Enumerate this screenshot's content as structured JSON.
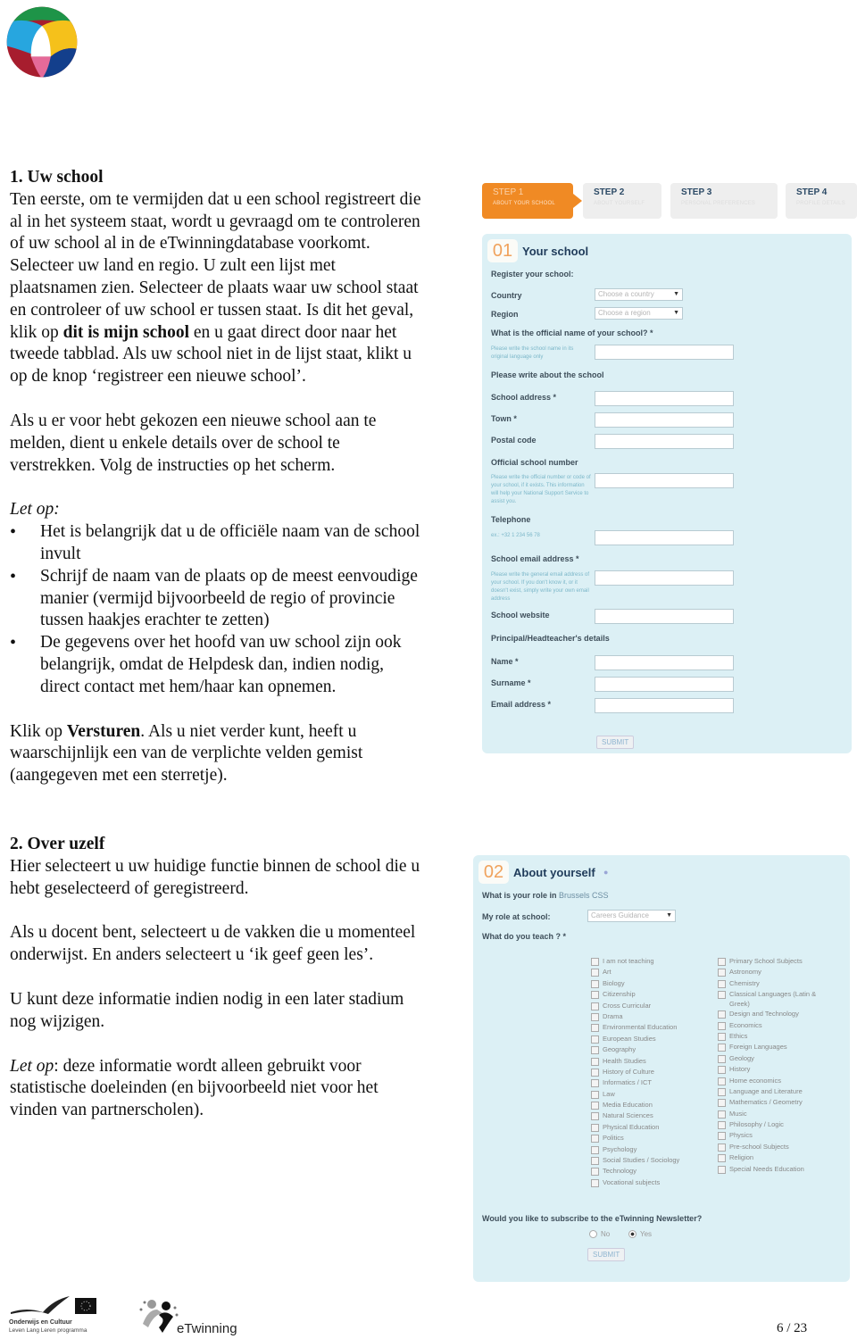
{
  "header": {
    "logo": "colored-circle-logo"
  },
  "section1": {
    "heading": "1. Uw school",
    "para1_lines": [
      "Ten eerste, om te vermijden dat u een school registreert die",
      "al in het systeem staat, wordt u gevraagd om te controleren",
      "of uw school al in de eTwinningdatabase voorkomt.",
      "Selecteer uw land en regio. U zult een lijst met",
      "plaatsnamen zien. Selecteer de plaats waar uw school staat",
      "en controleer of uw school er tussen staat. Is dit het geval,"
    ],
    "para1_l7_pre": "klik op ",
    "para1_l7_bold": "dit is mijn school",
    "para1_l7_post": " en u gaat direct door naar het",
    "para1_l8": "tweede tabblad. Als uw school niet in de lijst staat, klikt u",
    "para1_l9": "op de knop ‘registreer een nieuwe school’.",
    "para2_lines": [
      "Als u er voor hebt gekozen een nieuwe school aan te",
      "melden, dient u enkele details over de school te",
      "verstrekken. Volg de instructies op het scherm."
    ],
    "note_label": "Let op:",
    "bullets": [
      [
        "Het is belangrijk dat u de officiële naam van de school",
        "invult"
      ],
      [
        "Schrijf de naam van de plaats op de meest eenvoudige",
        "manier (vermijd bijvoorbeeld de regio of provincie",
        "tussen haakjes erachter te zetten)"
      ],
      [
        "De gegevens over het hoofd van uw school zijn ook",
        "belangrijk, omdat de Helpdesk dan, indien nodig,",
        "direct contact met hem/haar kan opnemen."
      ]
    ],
    "para3_pre": "Klik op ",
    "para3_bold": "Versturen",
    "para3_post": ". Als u niet verder kunt, heeft u",
    "para3_l2": "waarschijnlijk een van de verplichte velden gemist",
    "para3_l3": "(aangegeven met een sterretje)."
  },
  "steps": [
    {
      "title": "STEP 1",
      "subtitle": "ABOUT YOUR SCHOOL",
      "active": true
    },
    {
      "title": "STEP 2",
      "subtitle": "ABOUT YOURSELF",
      "active": false
    },
    {
      "title": "STEP 3",
      "subtitle": "PERSONAL PREFERENCES",
      "active": false
    },
    {
      "title": "STEP 4",
      "subtitle": "PROFILE DETAILS",
      "active": false
    }
  ],
  "form1": {
    "number": "01",
    "title": "Your school",
    "register_label": "Register your school:",
    "country_label": "Country",
    "country_value": "Choose a country",
    "region_label": "Region",
    "region_value": "Choose a region",
    "official_name_q": "What is the official name of your school? *",
    "official_name_hint": "Please write the school name in its original language only",
    "write_about": "Please write about the school",
    "address_label": "School address *",
    "town_label": "Town *",
    "postal_label": "Postal code",
    "school_number_label": "Official school number",
    "school_number_hint": "Please write the official number or code of your school, if it exists. This information will help your National Support Service to assist you.",
    "telephone_label": "Telephone",
    "telephone_hint": "ex.: +32 1 234 56 78",
    "email_label": "School email address *",
    "email_hint": "Please write the general email address of your school. If you don't know it, or it doesn't exist, simply write your own email address",
    "website_label": "School website",
    "principal_heading": "Principal/Headteacher's details",
    "name_label": "Name *",
    "surname_label": "Surname *",
    "principal_email_label": "Email address *",
    "submit": "SUBMIT"
  },
  "section2": {
    "heading": "2. Over uzelf",
    "p1": [
      "Hier selecteert u uw huidige functie binnen de school die u",
      "hebt geselecteerd of geregistreerd."
    ],
    "p2": [
      "Als u docent bent, selecteert u de vakken die u momenteel",
      "onderwijst. En anders selecteert u ‘ik geef geen les’."
    ],
    "p3": [
      "U kunt deze informatie indien nodig in een later stadium",
      "nog wijzigen."
    ],
    "p4_label": "Let op",
    "p4_l1": ": deze informatie wordt alleen gebruikt voor",
    "p4_l2": "statistische doeleinden (en bijvoorbeeld niet voor het",
    "p4_l3": "vinden van partnerscholen)."
  },
  "form2": {
    "number": "02",
    "title": "About yourself",
    "role_q_pre": "What is your role in ",
    "role_q_school": "Brussels CSS",
    "role_label": "My role at school:",
    "role_value": "Careers Guidance",
    "teach_q": "What do you teach ? *",
    "subjects_left": [
      "I am not teaching",
      "Art",
      "Biology",
      "Citizenship",
      "Cross Curricular",
      "Drama",
      "Environmental Education",
      "European Studies",
      "Geography",
      "Health Studies",
      "History of Culture",
      "Informatics / ICT",
      "Law",
      "Media Education",
      "Natural Sciences",
      "Physical Education",
      "Politics",
      "Psychology",
      "Social Studies / Sociology",
      "Technology",
      "Vocational subjects"
    ],
    "subjects_right": [
      "Primary School Subjects",
      "Astronomy",
      "Chemistry",
      "Classical Languages (Latin & Greek)",
      "Design and Technology",
      "Economics",
      "Ethics",
      "Foreign Languages",
      "Geology",
      "History",
      "Home economics",
      "Language and Literature",
      "Mathematics / Geometry",
      "Music",
      "Philosophy / Logic",
      "Physics",
      "Pre-school Subjects",
      "Religion",
      "Special Needs Education"
    ],
    "newsletter_q": "Would you like to subscribe to the eTwinning Newsletter?",
    "no_label": "No",
    "yes_label": "Yes",
    "newsletter_selected": "Yes",
    "submit": "SUBMIT"
  },
  "footer": {
    "llp_line1": "Onderwijs en Cultuur",
    "llp_line2": "Leven Lang Leren programma",
    "etwinning": "eTwinning",
    "page": "6 / 23"
  }
}
